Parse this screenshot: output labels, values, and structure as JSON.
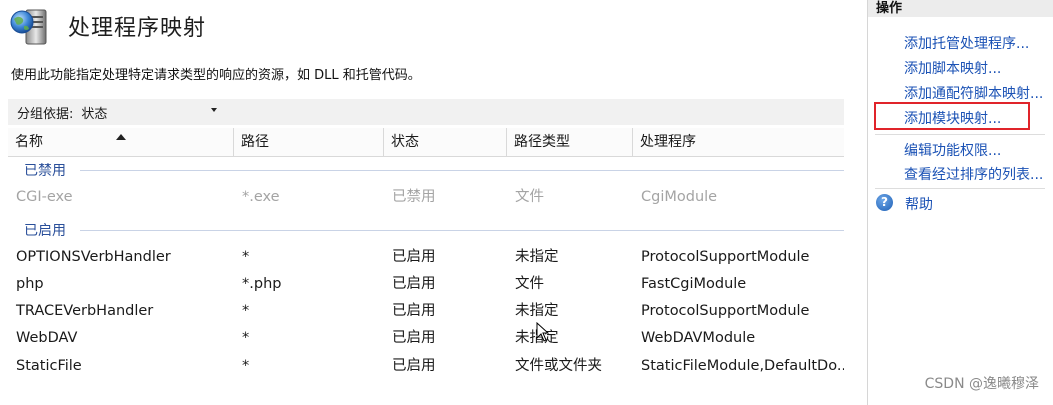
{
  "page": {
    "title": "处理程序映射",
    "description": "使用此功能指定处理特定请求类型的响应的资源，如 DLL 和托管代码。"
  },
  "group_by": {
    "label": "分组依据:",
    "value": "状态"
  },
  "columns": [
    "名称",
    "路径",
    "状态",
    "路径类型",
    "处理程序"
  ],
  "groups": [
    {
      "label": "已禁用",
      "rows": [
        {
          "name": "CGI-exe",
          "path": "*.exe",
          "state": "已禁用",
          "path_type": "文件",
          "handler": "CgiModule"
        }
      ]
    },
    {
      "label": "已启用",
      "rows": [
        {
          "name": "OPTIONSVerbHandler",
          "path": "*",
          "state": "已启用",
          "path_type": "未指定",
          "handler": "ProtocolSupportModule"
        },
        {
          "name": "php",
          "path": "*.php",
          "state": "已启用",
          "path_type": "文件",
          "handler": "FastCgiModule"
        },
        {
          "name": "TRACEVerbHandler",
          "path": "*",
          "state": "已启用",
          "path_type": "未指定",
          "handler": "ProtocolSupportModule"
        },
        {
          "name": "WebDAV",
          "path": "*",
          "state": "已启用",
          "path_type": "未指定",
          "handler": "WebDAVModule"
        },
        {
          "name": "StaticFile",
          "path": "*",
          "state": "已启用",
          "path_type": "文件或文件夹",
          "handler": "StaticFileModule,DefaultDo..."
        }
      ]
    }
  ],
  "actions": {
    "title": "操作",
    "links": [
      "添加托管处理程序...",
      "添加脚本映射...",
      "添加通配符脚本映射...",
      "添加模块映射...",
      "编辑功能权限...",
      "查看经过排序的列表..."
    ],
    "help": "帮助",
    "highlighted_index": 3
  },
  "watermark": "CSDN @逸曦穆泽",
  "colors": {
    "link": "#1b52b5",
    "group_label": "#2a4f9a",
    "highlight": "#e0242a",
    "disabled_text": "#a4a4a4"
  }
}
